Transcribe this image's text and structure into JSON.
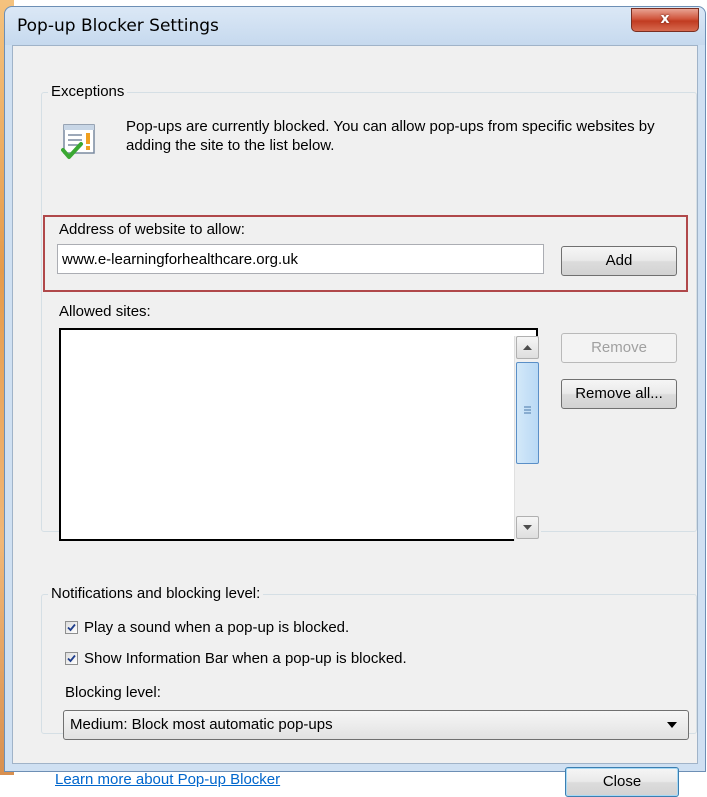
{
  "window": {
    "title": "Pop-up Blocker Settings",
    "close_glyph": "x"
  },
  "exceptions": {
    "legend": "Exceptions",
    "info_text": "Pop-ups are currently blocked.  You can allow pop-ups from specific websites by adding the site to the list below.",
    "address_label": "Address of website to allow:",
    "address_value": "www.e-learningforhealthcare.org.uk",
    "add_label": "Add",
    "allowed_label": "Allowed sites:",
    "allowed_sites": [],
    "remove_label": "Remove",
    "remove_all_label": "Remove all..."
  },
  "notifications": {
    "legend": "Notifications and blocking level:",
    "play_sound_label": "Play a sound when a pop-up is blocked.",
    "play_sound_checked": true,
    "info_bar_label": "Show Information Bar when a pop-up is blocked.",
    "info_bar_checked": true,
    "blocking_level_label": "Blocking level:",
    "blocking_level_value": "Medium: Block most automatic pop-ups"
  },
  "footer": {
    "learn_more_label": "Learn more about Pop-up Blocker",
    "close_label": "Close"
  },
  "colors": {
    "highlight_border": "#b0484a",
    "link": "#0066cc",
    "close_button": "#c13b21"
  },
  "icons": [
    "popup-blocked-icon",
    "checkmark-icon",
    "scroll-up-arrow-icon",
    "scroll-down-arrow-icon",
    "dropdown-arrow-icon",
    "close-x-icon"
  ]
}
